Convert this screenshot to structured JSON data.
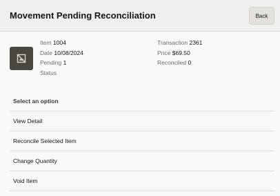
{
  "header": {
    "title": "Movement Pending Reconciliation",
    "back_label": "Back"
  },
  "item": {
    "image_icon": "image-unavailable-icon",
    "left": [
      {
        "label": "Item",
        "value": "1004"
      },
      {
        "label": "Date",
        "value": "10/08/2024"
      },
      {
        "label": "Pending",
        "value": "1"
      },
      {
        "label": "Status",
        "value": ""
      }
    ],
    "right": [
      {
        "label": "Transaction",
        "value": "2361"
      },
      {
        "label": "Price",
        "value": "$69.50"
      },
      {
        "label": "Reconciled",
        "value": "0"
      }
    ]
  },
  "menu": {
    "heading": "Select an option",
    "items": [
      {
        "label": "View Detail"
      },
      {
        "label": "Reconcile Selected Item"
      },
      {
        "label": "Change Quantity"
      },
      {
        "label": "Void Item"
      }
    ]
  }
}
